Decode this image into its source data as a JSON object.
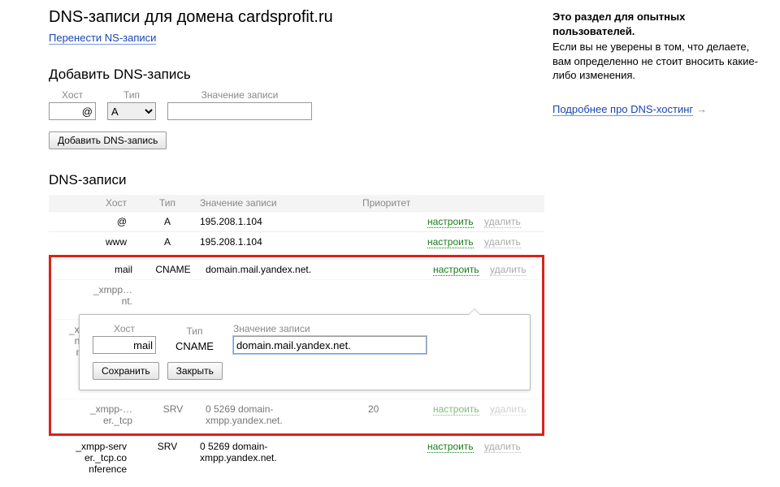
{
  "header": {
    "title": "DNS-записи для домена cardsprofit.ru",
    "transfer_link": "Перенести NS-записи"
  },
  "add_section": {
    "title": "Добавить DNS-запись",
    "host_label": "Хост",
    "type_label": "Тип",
    "value_label": "Значение записи",
    "host_value": "@",
    "type_value": "A",
    "button": "Добавить DNS-запись"
  },
  "records_section": {
    "title": "DNS-записи",
    "cols": {
      "host": "Хост",
      "type": "Тип",
      "value": "Значение записи",
      "priority": "Приоритет"
    },
    "actions": {
      "configure": "настроить",
      "delete": "удалить"
    },
    "rows_top": [
      {
        "host": "@",
        "type": "A",
        "value": "195.208.1.104",
        "priority": ""
      },
      {
        "host": "www",
        "type": "A",
        "value": "195.208.1.104",
        "priority": ""
      }
    ],
    "row_mail": {
      "host": "mail",
      "type": "CNAME",
      "value": "domain.mail.yandex.net.",
      "priority": ""
    },
    "row_cut1": {
      "host": "_xmpp…\nnt.",
      "type": "",
      "value": "",
      "priority": ""
    },
    "row_cut2": {
      "host": "_xmpp…\nnt._tc…\nnfere…"
    },
    "row_cut3": {
      "host": "_xmpp-…\ner._tcp",
      "type": "SRV",
      "value": "0 5269 domain-\nxmpp.yandex.net.",
      "priority": "20"
    },
    "row_bottom": {
      "host": "_xmpp-serv\ner._tcp.co\nnference",
      "type": "SRV",
      "value": "0 5269 domain-\nxmpp.yandex.net.",
      "priority": ""
    }
  },
  "edit": {
    "host_label": "Хост",
    "type_label": "Тип",
    "value_label": "Значение записи",
    "host_value": "mail",
    "type_value": "CNAME",
    "value_value": "domain.mail.yandex.net.",
    "save": "Сохранить",
    "close": "Закрыть"
  },
  "side": {
    "bold": "Это раздел для опытных пользователей.",
    "text": "Если вы не уверены в том, что делаете, вам определенно не стоит вносить какие-либо изменения.",
    "learn_link": "Подробнее про DNS-хостинг"
  }
}
